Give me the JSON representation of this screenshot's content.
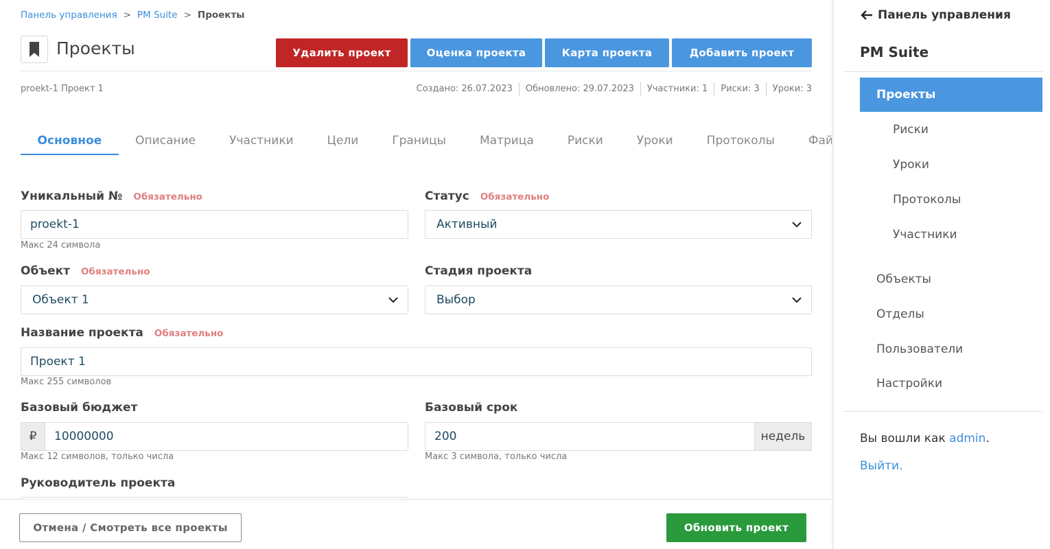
{
  "breadcrumb": {
    "items": [
      "Панель управления",
      "PM Suite"
    ],
    "current": "Проекты",
    "separator": ">"
  },
  "header": {
    "icon": "bookmark-icon",
    "title": "Проекты",
    "buttons": {
      "delete": "Удалить проект",
      "evaluate": "Оценка проекта",
      "map": "Карта проекта",
      "add": "Добавить проект"
    }
  },
  "meta": {
    "left": "proekt-1 Проект 1",
    "created": "Создано: 26.07.2023",
    "updated": "Обновлено: 29.07.2023",
    "participants": "Участники: 1",
    "risks": "Риски: 3",
    "lessons": "Уроки: 3"
  },
  "tabs": [
    "Основное",
    "Описание",
    "Участники",
    "Цели",
    "Границы",
    "Матрица",
    "Риски",
    "Уроки",
    "Протоколы",
    "Файл"
  ],
  "active_tab": "Основное",
  "form": {
    "required_label": "Обязательно",
    "unique_no": {
      "label": "Уникальный №",
      "value": "proekt-1",
      "hint": "Макс 24 символа"
    },
    "status": {
      "label": "Статус",
      "value": "Активный"
    },
    "object": {
      "label": "Объект",
      "value": "Объект 1"
    },
    "stage": {
      "label": "Стадия проекта",
      "value": "Выбор"
    },
    "name": {
      "label": "Название проекта",
      "value": "Проект 1",
      "hint": "Макс 255 символов"
    },
    "budget": {
      "label": "Базовый бюджет",
      "prefix": "₽",
      "value": "10000000",
      "hint": "Макс 12 символов, только числа"
    },
    "term": {
      "label": "Базовый срок",
      "value": "200",
      "suffix": "недель",
      "hint": "Макс 3 символа, только числа"
    },
    "manager": {
      "label": "Руководитель проекта"
    }
  },
  "footer": {
    "cancel": "Отмена / Смотреть все проекты",
    "update": "Обновить проект"
  },
  "sidebar": {
    "back": "Панель управления",
    "title": "PM Suite",
    "active": "Проекты",
    "sub_items": [
      "Риски",
      "Уроки",
      "Протоколы",
      "Участники"
    ],
    "items": [
      "Объекты",
      "Отделы",
      "Пользователи",
      "Настройки"
    ],
    "logged_in_prefix": "Вы вошли как",
    "user": "admin",
    "logged_in_suffix": ".",
    "logout": "Выйти."
  },
  "colors": {
    "accent": "#4a96df",
    "danger": "#c02626",
    "success": "#2a9a3c",
    "required": "#e07f7f"
  }
}
